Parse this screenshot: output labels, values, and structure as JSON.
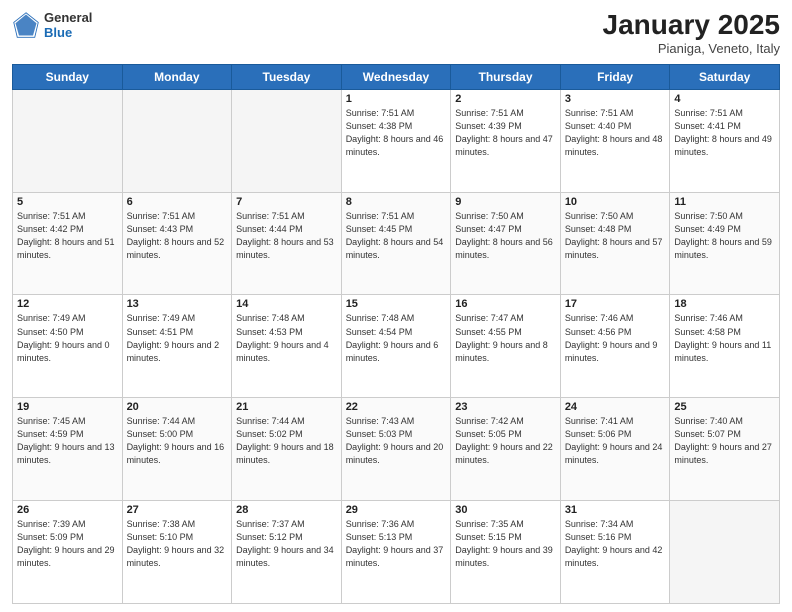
{
  "header": {
    "logo_general": "General",
    "logo_blue": "Blue",
    "month": "January 2025",
    "location": "Pianiga, Veneto, Italy"
  },
  "days_of_week": [
    "Sunday",
    "Monday",
    "Tuesday",
    "Wednesday",
    "Thursday",
    "Friday",
    "Saturday"
  ],
  "weeks": [
    [
      {
        "day": "",
        "info": ""
      },
      {
        "day": "",
        "info": ""
      },
      {
        "day": "",
        "info": ""
      },
      {
        "day": "1",
        "info": "Sunrise: 7:51 AM\nSunset: 4:38 PM\nDaylight: 8 hours\nand 46 minutes."
      },
      {
        "day": "2",
        "info": "Sunrise: 7:51 AM\nSunset: 4:39 PM\nDaylight: 8 hours\nand 47 minutes."
      },
      {
        "day": "3",
        "info": "Sunrise: 7:51 AM\nSunset: 4:40 PM\nDaylight: 8 hours\nand 48 minutes."
      },
      {
        "day": "4",
        "info": "Sunrise: 7:51 AM\nSunset: 4:41 PM\nDaylight: 8 hours\nand 49 minutes."
      }
    ],
    [
      {
        "day": "5",
        "info": "Sunrise: 7:51 AM\nSunset: 4:42 PM\nDaylight: 8 hours\nand 51 minutes."
      },
      {
        "day": "6",
        "info": "Sunrise: 7:51 AM\nSunset: 4:43 PM\nDaylight: 8 hours\nand 52 minutes."
      },
      {
        "day": "7",
        "info": "Sunrise: 7:51 AM\nSunset: 4:44 PM\nDaylight: 8 hours\nand 53 minutes."
      },
      {
        "day": "8",
        "info": "Sunrise: 7:51 AM\nSunset: 4:45 PM\nDaylight: 8 hours\nand 54 minutes."
      },
      {
        "day": "9",
        "info": "Sunrise: 7:50 AM\nSunset: 4:47 PM\nDaylight: 8 hours\nand 56 minutes."
      },
      {
        "day": "10",
        "info": "Sunrise: 7:50 AM\nSunset: 4:48 PM\nDaylight: 8 hours\nand 57 minutes."
      },
      {
        "day": "11",
        "info": "Sunrise: 7:50 AM\nSunset: 4:49 PM\nDaylight: 8 hours\nand 59 minutes."
      }
    ],
    [
      {
        "day": "12",
        "info": "Sunrise: 7:49 AM\nSunset: 4:50 PM\nDaylight: 9 hours\nand 0 minutes."
      },
      {
        "day": "13",
        "info": "Sunrise: 7:49 AM\nSunset: 4:51 PM\nDaylight: 9 hours\nand 2 minutes."
      },
      {
        "day": "14",
        "info": "Sunrise: 7:48 AM\nSunset: 4:53 PM\nDaylight: 9 hours\nand 4 minutes."
      },
      {
        "day": "15",
        "info": "Sunrise: 7:48 AM\nSunset: 4:54 PM\nDaylight: 9 hours\nand 6 minutes."
      },
      {
        "day": "16",
        "info": "Sunrise: 7:47 AM\nSunset: 4:55 PM\nDaylight: 9 hours\nand 8 minutes."
      },
      {
        "day": "17",
        "info": "Sunrise: 7:46 AM\nSunset: 4:56 PM\nDaylight: 9 hours\nand 9 minutes."
      },
      {
        "day": "18",
        "info": "Sunrise: 7:46 AM\nSunset: 4:58 PM\nDaylight: 9 hours\nand 11 minutes."
      }
    ],
    [
      {
        "day": "19",
        "info": "Sunrise: 7:45 AM\nSunset: 4:59 PM\nDaylight: 9 hours\nand 13 minutes."
      },
      {
        "day": "20",
        "info": "Sunrise: 7:44 AM\nSunset: 5:00 PM\nDaylight: 9 hours\nand 16 minutes."
      },
      {
        "day": "21",
        "info": "Sunrise: 7:44 AM\nSunset: 5:02 PM\nDaylight: 9 hours\nand 18 minutes."
      },
      {
        "day": "22",
        "info": "Sunrise: 7:43 AM\nSunset: 5:03 PM\nDaylight: 9 hours\nand 20 minutes."
      },
      {
        "day": "23",
        "info": "Sunrise: 7:42 AM\nSunset: 5:05 PM\nDaylight: 9 hours\nand 22 minutes."
      },
      {
        "day": "24",
        "info": "Sunrise: 7:41 AM\nSunset: 5:06 PM\nDaylight: 9 hours\nand 24 minutes."
      },
      {
        "day": "25",
        "info": "Sunrise: 7:40 AM\nSunset: 5:07 PM\nDaylight: 9 hours\nand 27 minutes."
      }
    ],
    [
      {
        "day": "26",
        "info": "Sunrise: 7:39 AM\nSunset: 5:09 PM\nDaylight: 9 hours\nand 29 minutes."
      },
      {
        "day": "27",
        "info": "Sunrise: 7:38 AM\nSunset: 5:10 PM\nDaylight: 9 hours\nand 32 minutes."
      },
      {
        "day": "28",
        "info": "Sunrise: 7:37 AM\nSunset: 5:12 PM\nDaylight: 9 hours\nand 34 minutes."
      },
      {
        "day": "29",
        "info": "Sunrise: 7:36 AM\nSunset: 5:13 PM\nDaylight: 9 hours\nand 37 minutes."
      },
      {
        "day": "30",
        "info": "Sunrise: 7:35 AM\nSunset: 5:15 PM\nDaylight: 9 hours\nand 39 minutes."
      },
      {
        "day": "31",
        "info": "Sunrise: 7:34 AM\nSunset: 5:16 PM\nDaylight: 9 hours\nand 42 minutes."
      },
      {
        "day": "",
        "info": ""
      }
    ]
  ]
}
